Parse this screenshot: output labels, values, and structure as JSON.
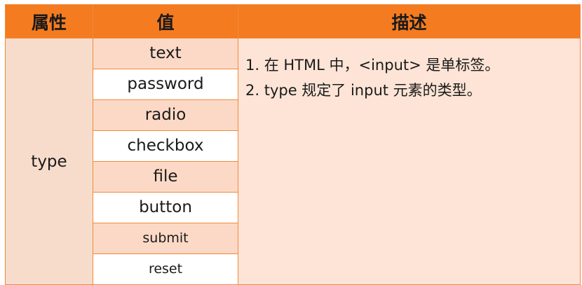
{
  "headers": {
    "attribute": "属性",
    "value": "值",
    "description": "描述"
  },
  "type_label": "type",
  "values": [
    "text",
    "password",
    "radio",
    "checkbox",
    "file",
    "button",
    "submit",
    "reset"
  ],
  "description": [
    "1. 在 HTML 中，<input> 是单标签。",
    "2. type 规定了 input 元素的类型。"
  ],
  "colors": {
    "header_bg": "#f47b20",
    "border": "#ef8a3a",
    "type_cell_bg": "#f8dccb",
    "value_shaded_bg": "#fcd9c6",
    "description_bg": "#fde4d6"
  }
}
